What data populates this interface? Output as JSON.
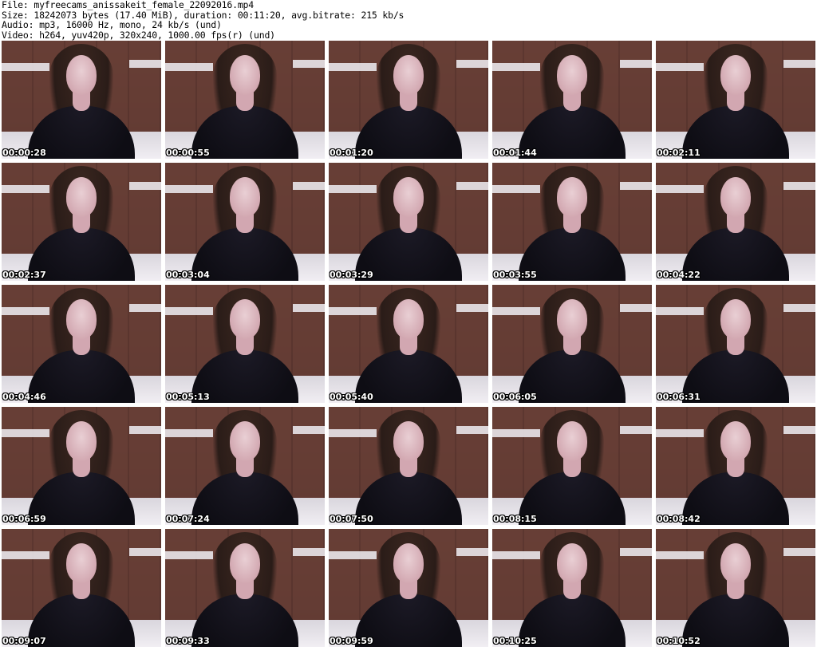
{
  "header": {
    "line1": "File: myfreecams_anissakeit_female_22092016.mp4",
    "line2": "Size: 18242073 bytes (17.40 MiB), duration: 00:11:20, avg.bitrate: 215 kb/s",
    "line3": "Audio: mp3, 16000 Hz, mono, 24 kb/s (und)",
    "line4": "Video: h264, yuv420p, 320x240, 1000.00 fps(r) (und)"
  },
  "thumbnails": [
    {
      "timestamp": "00:00:28"
    },
    {
      "timestamp": "00:00:55"
    },
    {
      "timestamp": "00:01:20"
    },
    {
      "timestamp": "00:01:44"
    },
    {
      "timestamp": "00:02:11"
    },
    {
      "timestamp": "00:02:37"
    },
    {
      "timestamp": "00:03:04"
    },
    {
      "timestamp": "00:03:29"
    },
    {
      "timestamp": "00:03:55"
    },
    {
      "timestamp": "00:04:22"
    },
    {
      "timestamp": "00:04:46"
    },
    {
      "timestamp": "00:05:13"
    },
    {
      "timestamp": "00:05:40"
    },
    {
      "timestamp": "00:06:05"
    },
    {
      "timestamp": "00:06:31"
    },
    {
      "timestamp": "00:06:59"
    },
    {
      "timestamp": "00:07:24"
    },
    {
      "timestamp": "00:07:50"
    },
    {
      "timestamp": "00:08:15"
    },
    {
      "timestamp": "00:08:42"
    },
    {
      "timestamp": "00:09:07"
    },
    {
      "timestamp": "00:09:33"
    },
    {
      "timestamp": "00:09:59"
    },
    {
      "timestamp": "00:10:25"
    },
    {
      "timestamp": "00:10:52"
    }
  ]
}
